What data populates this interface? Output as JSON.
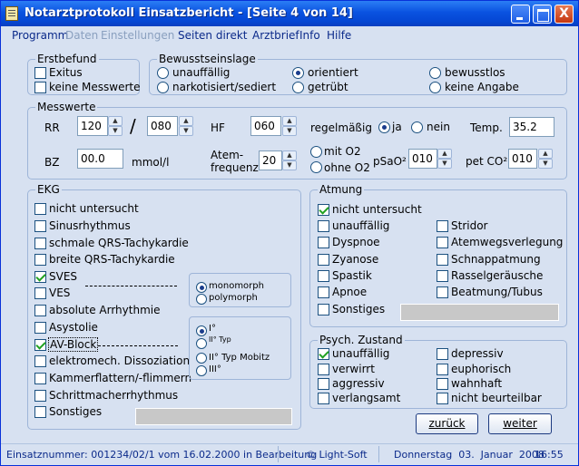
{
  "window": {
    "title": "Notarztprotokoll Einsatzbericht - [Seite 4 von 14]",
    "close_glyph": "X"
  },
  "menu": {
    "programm": "Programm",
    "daten": "Daten",
    "einstellungen": "Einstellungen",
    "seiten_direkt": "Seiten direkt",
    "arztbrief": "Arztbrief",
    "info": "Info",
    "hilfe": "Hilfe"
  },
  "erstbefund": {
    "title": "Erstbefund",
    "exitus": "Exitus",
    "keine_messwerte": "keine Messwerte"
  },
  "bewusstseinslage": {
    "title": "Bewusstseinslage",
    "options": {
      "unauffaellig": "unauffällig",
      "orientiert": "orientiert",
      "bewusstlos": "bewusstlos",
      "narkotisiert": "narkotisiert/sediert",
      "getruebt": "getrübt",
      "keine_angabe": "keine Angabe"
    },
    "selected": "orientiert"
  },
  "messwerte": {
    "title": "Messwerte",
    "rr_label": "RR",
    "rr_sys": "120",
    "rr_sep": "/",
    "rr_dia": "080",
    "hf_label": "HF",
    "hf": "060",
    "regel_label": "regelmäßig",
    "ja": "ja",
    "nein": "nein",
    "regel_selected": "ja",
    "temp_label": "Temp.",
    "temp": "35.2",
    "bz_label": "BZ",
    "bz": "00.0",
    "bz_unit": "mmol/l",
    "af_label1": "Atem-",
    "af_label2": "frequenz",
    "af": "20",
    "mit_o2": "mit O2",
    "ohne_o2": "ohne O2",
    "psao2_label": "pSaO²",
    "psao2": "010",
    "petco2_label": "pet CO²",
    "petco2": "010"
  },
  "ekg": {
    "title": "EKG",
    "items": {
      "nicht_untersucht": "nicht untersucht",
      "sinusrhythmus": "Sinusrhythmus",
      "schmale": "schmale QRS-Tachykardie",
      "breite": "breite QRS-Tachykardie",
      "sves": "SVES",
      "ves": "VES",
      "absolute": "absolute Arrhythmie",
      "asystolie": "Asystolie",
      "av_block": "AV-Block",
      "elektromech": "elektromech. Dissoziation",
      "kammerflattern": "Kammerflattern/-flimmern",
      "schrittmacher": "Schrittmacherrhythmus",
      "sonstiges": "Sonstiges"
    },
    "checked": [
      "sves",
      "av_block"
    ],
    "ves_type": {
      "monomorph": "monomorph",
      "polymorph": "polymorph",
      "selected": "monomorph"
    },
    "av_grade": {
      "g1": "I°",
      "g2a": "II° Typ",
      "g2b": "II° Typ Mobitz",
      "g3": "III°",
      "selected": "g1"
    }
  },
  "atmung": {
    "title": "Atmung",
    "items": {
      "nicht_untersucht": "nicht untersucht",
      "unauffaellig": "unauffällig",
      "stridor": "Stridor",
      "dyspnoe": "Dyspnoe",
      "atemwegsverlegung": "Atemwegsverlegung",
      "zyanose": "Zyanose",
      "schnappatmung": "Schnappatmung",
      "spastik": "Spastik",
      "rasselgeraeusche": "Rasselgeräusche",
      "apnoe": "Apnoe",
      "beatmung": "Beatmung/Tubus",
      "sonstiges": "Sonstiges"
    },
    "checked": [
      "nicht_untersucht"
    ]
  },
  "psych": {
    "title": "Psych. Zustand",
    "items": {
      "unauffaellig": "unauffällig",
      "depressiv": "depressiv",
      "verwirrt": "verwirrt",
      "euphorisch": "euphorisch",
      "aggressiv": "aggressiv",
      "wahnhaft": "wahnhaft",
      "verlangsamt": "verlangsamt",
      "nicht_beurteilbar": "nicht beurteilbar"
    },
    "checked": [
      "unauffaellig"
    ]
  },
  "buttons": {
    "zurueck": "zurück",
    "weiter": "weiter"
  },
  "status": {
    "einsatz": "Einsatznummer: 001234/02/1 vom 16.02.2000 in Bearbeitung",
    "copyright": "© Light-Soft",
    "date": "Donnerstag  03.  Januar  2008",
    "time": "16:55"
  }
}
